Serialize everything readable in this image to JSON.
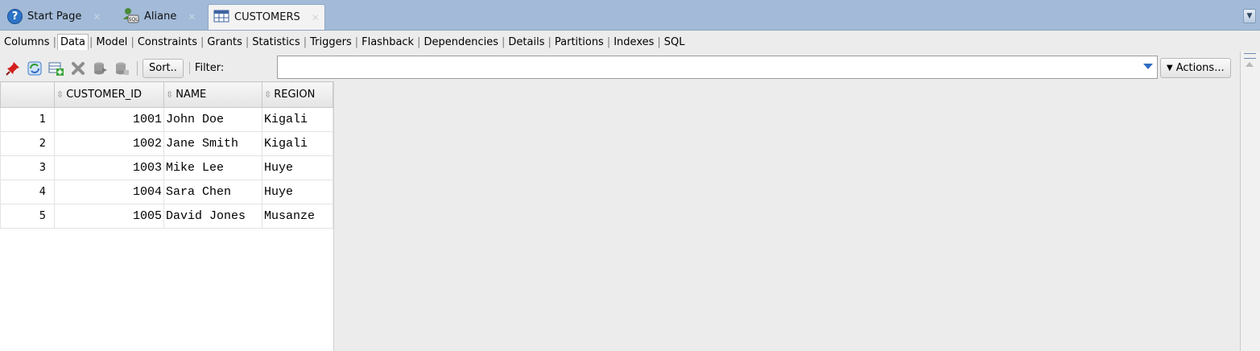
{
  "tabs": [
    {
      "label": "Start Page",
      "icon": "help-icon",
      "active": false
    },
    {
      "label": "Aliane",
      "icon": "sql-connection-icon",
      "active": false
    },
    {
      "label": "CUSTOMERS",
      "icon": "table-icon",
      "active": true
    }
  ],
  "subtabs": [
    "Columns",
    "Data",
    "Model",
    "Constraints",
    "Grants",
    "Statistics",
    "Triggers",
    "Flashback",
    "Dependencies",
    "Details",
    "Partitions",
    "Indexes",
    "SQL"
  ],
  "active_subtab": "Data",
  "toolbar": {
    "sort_label": "Sort..",
    "filter_label": "Filter:",
    "filter_value": "",
    "actions_label": "Actions..."
  },
  "grid": {
    "columns": [
      "CUSTOMER_ID",
      "NAME",
      "REGION"
    ],
    "rows": [
      {
        "num": "1",
        "customer_id": "1001",
        "name": "John Doe",
        "region": "Kigali"
      },
      {
        "num": "2",
        "customer_id": "1002",
        "name": "Jane Smith",
        "region": "Kigali"
      },
      {
        "num": "3",
        "customer_id": "1003",
        "name": "Mike Lee",
        "region": "Huye"
      },
      {
        "num": "4",
        "customer_id": "1004",
        "name": "Sara Chen",
        "region": "Huye"
      },
      {
        "num": "5",
        "customer_id": "1005",
        "name": "David Jones",
        "region": "Musanze"
      }
    ]
  },
  "colors": {
    "tabbar": "#a3bbd8",
    "accent_blue": "#2f6bc2",
    "background": "#ececec"
  }
}
